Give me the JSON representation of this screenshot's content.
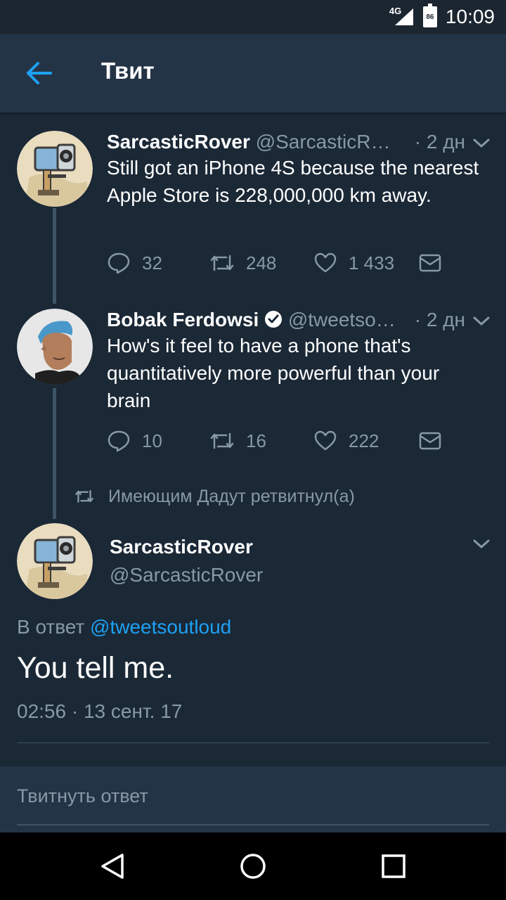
{
  "status_bar": {
    "network": "4G",
    "battery": "86",
    "time": "10:09"
  },
  "app_bar": {
    "back_icon": "arrow-left-icon",
    "title": "Твит"
  },
  "thread": [
    {
      "avatar_icon": "rover-avatar",
      "name": "SarcasticRover",
      "handle": "@SarcasticR…",
      "time": "· 2 дн",
      "text": "Still got an iPhone 4S because the nearest Apple Store is 228,000,000 km away.",
      "replies": "32",
      "retweets": "248",
      "likes": "1 433"
    },
    {
      "avatar_icon": "person-avatar",
      "name": "Bobak Ferdowsi",
      "verified_icon": "verified-badge-icon",
      "handle": "@tweetso…",
      "time": "· 2 дн",
      "text": "How's it feel to have a phone that's quantitatively more powerful than your brain",
      "replies": "10",
      "retweets": "16",
      "likes": "222"
    }
  ],
  "retweet_note": "Имеющим Дадут ретвитнул(а)",
  "main_tweet": {
    "name": "SarcasticRover",
    "handle": "@SarcasticRover",
    "reply_prefix": "В ответ",
    "reply_to": "@tweetsoutloud",
    "text": "You tell me.",
    "timestamp": "02:56 · 13 сент. 17"
  },
  "composer": {
    "placeholder": "Твитнуть ответ"
  },
  "colors": {
    "background": "#1b2836",
    "app_bar": "#243447",
    "secondary_text": "#8899a6",
    "link": "#1da1f2"
  }
}
